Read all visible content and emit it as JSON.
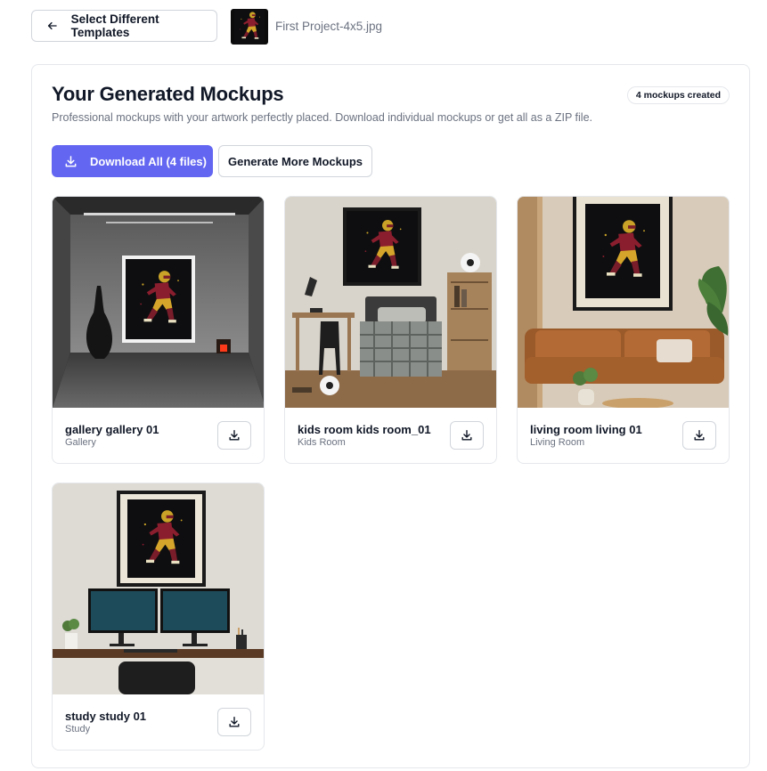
{
  "topbar": {
    "back_label": "Select Different Templates",
    "file_name": "First Project-4x5.jpg"
  },
  "panel": {
    "title": "Your Generated Mockups",
    "subtitle": "Professional mockups with your artwork perfectly placed. Download individual mockups or get all as a ZIP file.",
    "count_badge": "4 mockups created",
    "download_all_label": "Download All (4 files)",
    "generate_more_label": "Generate More Mockups"
  },
  "mockups": [
    {
      "title": "gallery gallery 01",
      "category": "Gallery"
    },
    {
      "title": "kids room kids room_01",
      "category": "Kids Room"
    },
    {
      "title": "living room living 01",
      "category": "Living Room"
    },
    {
      "title": "study study 01",
      "category": "Study"
    }
  ],
  "colors": {
    "accent": "#6366f1",
    "border": "#e5e7eb",
    "muted_text": "#6b7280"
  }
}
